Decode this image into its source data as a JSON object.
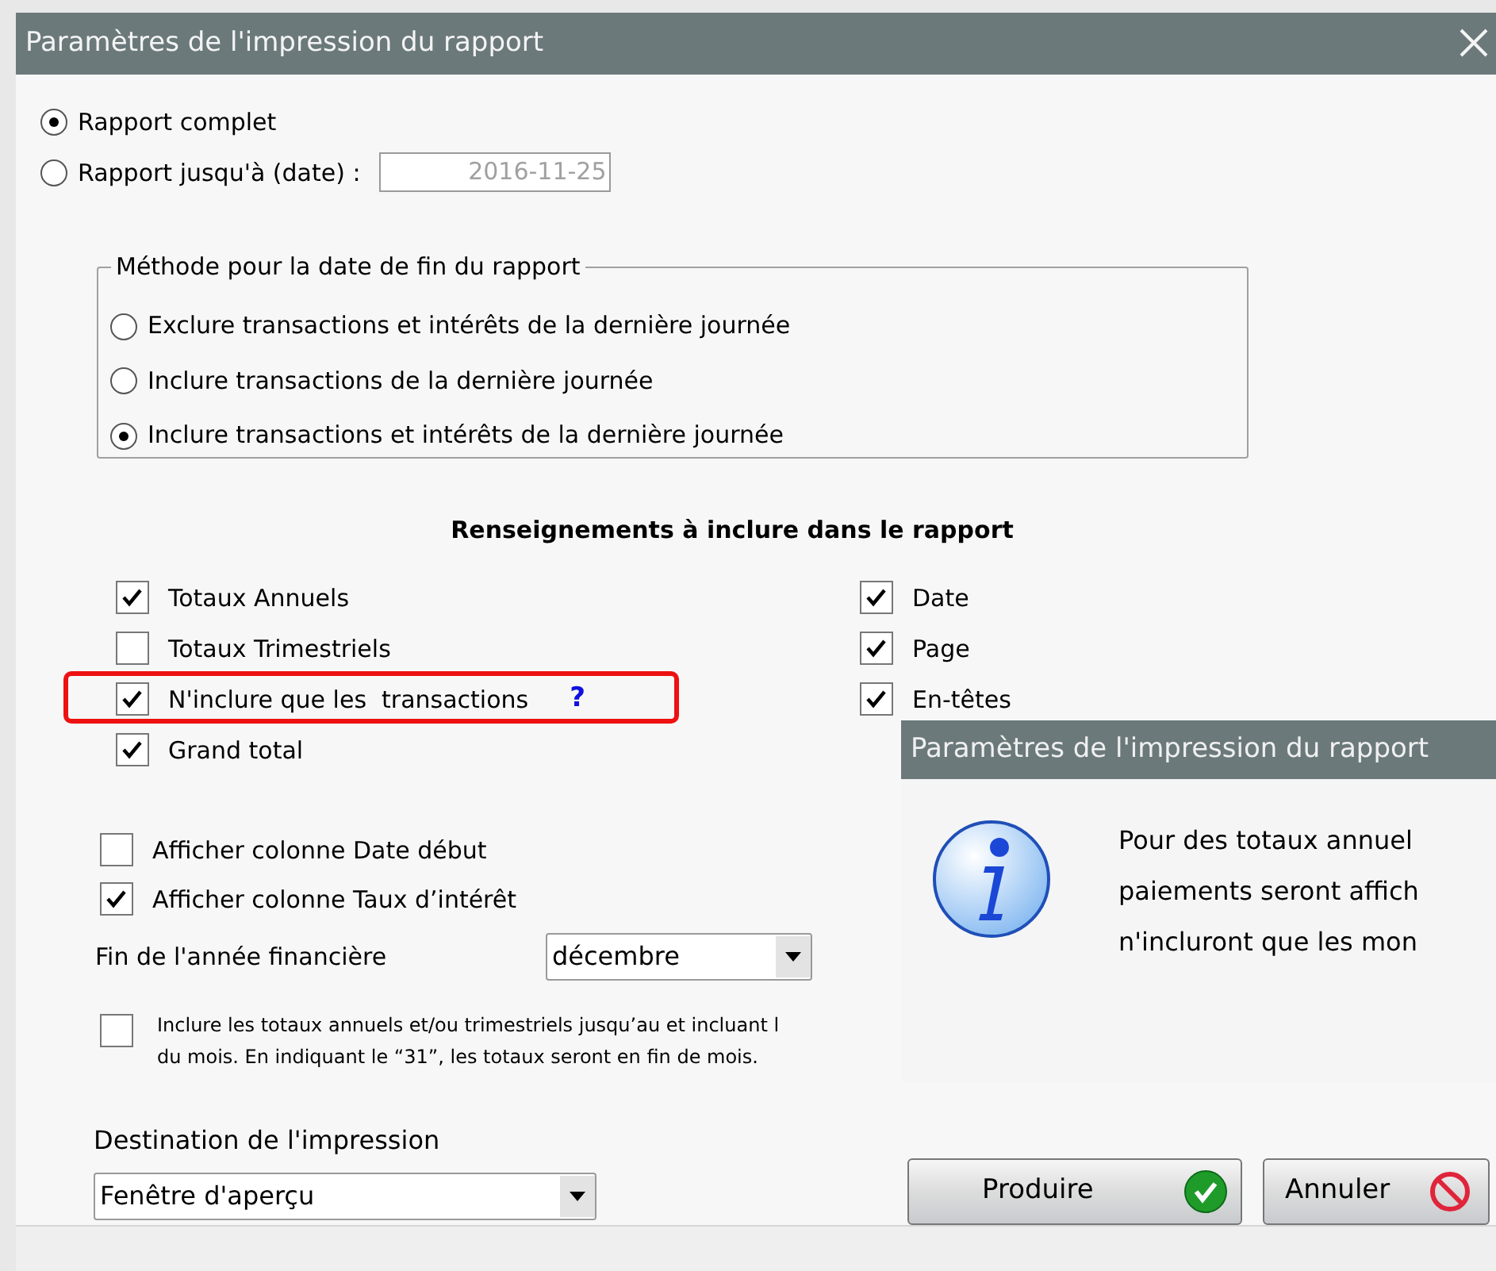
{
  "window": {
    "title": "Paramètres de l'impression du rapport"
  },
  "report_range": [
    {
      "label": "Rapport complet",
      "selected": true
    },
    {
      "label": "Rapport jusqu'à (date) :",
      "selected": false,
      "date": "2016-11-25"
    }
  ],
  "end_method": {
    "legend": "Méthode pour la date de fin du rapport",
    "options": [
      {
        "label": "Exclure transactions et intérêts de la dernière journée",
        "selected": false
      },
      {
        "label": "Inclure transactions de la dernière journée",
        "selected": false
      },
      {
        "label": "Inclure transactions et intérêts de la dernière journée",
        "selected": true
      }
    ]
  },
  "section_title": "Renseignements à inclure dans le rapport",
  "left_checks": [
    {
      "label": "Totaux Annuels",
      "checked": true,
      "highlighted": false
    },
    {
      "label": "Totaux Trimestriels",
      "checked": false,
      "highlighted": false
    },
    {
      "label": "N'inclure que les  transactions",
      "checked": true,
      "highlighted": true,
      "help": "?"
    },
    {
      "label": "Grand total",
      "checked": true,
      "highlighted": false
    }
  ],
  "right_checks": [
    {
      "label": "Date",
      "checked": true
    },
    {
      "label": "Page",
      "checked": true
    },
    {
      "label": "En-têtes",
      "checked": true
    }
  ],
  "display_checks": [
    {
      "label": "Afficher colonne Date début",
      "checked": false
    },
    {
      "label": "Afficher colonne Taux d’intérêt",
      "checked": true
    }
  ],
  "fiscal_year_end": {
    "label": "Fin de l'année financière",
    "value": "décembre"
  },
  "note_check": {
    "checked": false,
    "lines": [
      "Inclure les totaux annuels et/ou trimestriels jusqu’au et incluant l",
      "du mois. En indiquant le “31”, les totaux seront en fin de mois."
    ]
  },
  "destination": {
    "label": "Destination de l'impression",
    "value": "Fenêtre d'aperçu"
  },
  "buttons": [
    {
      "label": "Produire",
      "kind": "ok"
    },
    {
      "label": "Annuler",
      "kind": "cancel"
    }
  ],
  "info_dialog": {
    "title": "Paramètres de l'impression du rapport",
    "lines": [
      "Pour des totaux annuel",
      "paiements seront affich",
      "n'incluront que les mon"
    ]
  }
}
